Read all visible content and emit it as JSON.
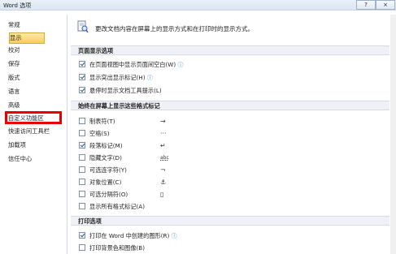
{
  "window": {
    "title": "Word 选项",
    "help_label": "?",
    "close_label": "×"
  },
  "sidebar": {
    "items": [
      {
        "label": "常规"
      },
      {
        "label": "显示"
      },
      {
        "label": "校对"
      },
      {
        "label": "保存"
      },
      {
        "label": "版式"
      },
      {
        "label": "语言"
      },
      {
        "label": "高级"
      },
      {
        "label": "自定义功能区"
      },
      {
        "label": "快速访问工具栏"
      },
      {
        "label": "加载项"
      },
      {
        "label": "信任中心"
      }
    ],
    "selected_index": 1,
    "highlighted_index": 7
  },
  "content": {
    "description": "更改文档内容在屏幕上的显示方式和在打印时的显示方式。",
    "page_display": {
      "header": "页面显示选项",
      "options": [
        {
          "label": "在页面视图中显示页面间空白(W)",
          "checked": true,
          "info": "ⓘ"
        },
        {
          "label": "显示突出显示标记(H)",
          "checked": true,
          "info": "ⓘ"
        },
        {
          "label": "悬停时显示文档工具提示(L)",
          "checked": true,
          "info": ""
        }
      ]
    },
    "format_marks": {
      "header": "始终在屏幕上显示这些格式标记",
      "options": [
        {
          "label": "制表符(T)",
          "checked": false,
          "symbol": "→"
        },
        {
          "label": "空格(S)",
          "checked": false,
          "symbol": "···"
        },
        {
          "label": "段落标记(M)",
          "checked": true,
          "symbol": "↵"
        },
        {
          "label": "隐藏文字(D)",
          "checked": false,
          "symbol": "abc"
        },
        {
          "label": "可选连字符(Y)",
          "checked": false,
          "symbol": "¬"
        },
        {
          "label": "对象位置(C)",
          "checked": false,
          "symbol": "⚓"
        },
        {
          "label": "可选分隔符(O)",
          "checked": false,
          "symbol": "▯"
        },
        {
          "label": "显示所有格式标记(A)",
          "checked": false,
          "symbol": ""
        }
      ]
    },
    "print_options": {
      "header": "打印选项",
      "options": [
        {
          "label": "打印在 Word 中创建的图形(R)",
          "checked": true,
          "info": "ⓘ"
        },
        {
          "label": "打印背景色和图像(B)",
          "checked": false,
          "info": ""
        }
      ]
    }
  }
}
